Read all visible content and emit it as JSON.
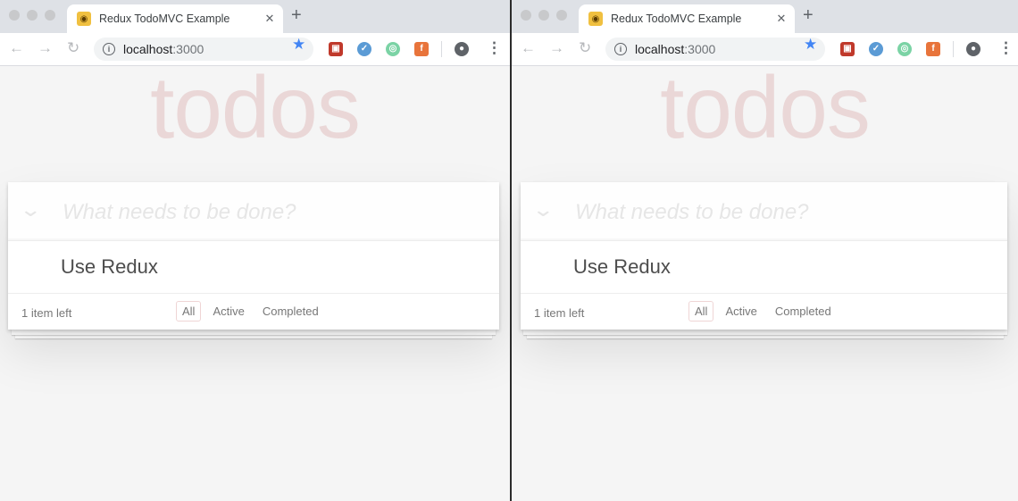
{
  "browser": {
    "tab_title": "Redux TodoMVC Example",
    "tab_close": "✕",
    "new_tab": "+",
    "url_host": "localhost",
    "url_port": ":3000",
    "back": "←",
    "forward": "→",
    "reload": "↻",
    "star": "★",
    "menu": "⋮"
  },
  "app": {
    "heading": "todos",
    "placeholder": "What needs to be done?",
    "toggle_all": "❯",
    "todos": [
      {
        "label": "Use Redux"
      }
    ],
    "count_text": "1 item left",
    "filters": [
      "All",
      "Active",
      "Completed"
    ],
    "selected_filter": "All"
  },
  "colors": {
    "accent": "#af2f2f",
    "star": "#4285f4"
  }
}
